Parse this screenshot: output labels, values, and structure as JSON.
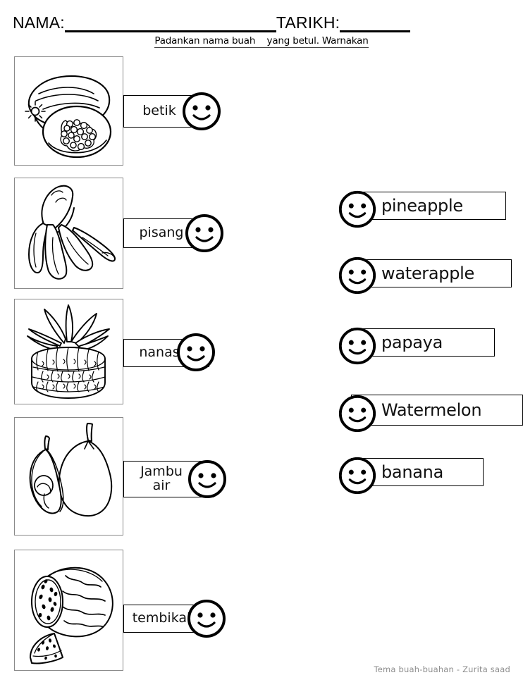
{
  "header": {
    "name_label": "NAMA:",
    "date_label": "TARIKH:"
  },
  "instruction": "Padankan nama buah    yang betul. Warnakan",
  "left_column": [
    {
      "label": "betik",
      "picture": "papaya-drawing"
    },
    {
      "label": "pisang",
      "picture": "banana-drawing"
    },
    {
      "label": "nanas",
      "picture": "pineapple-drawing"
    },
    {
      "label": "Jambu\nair",
      "picture": "waterapple-drawing"
    },
    {
      "label": "tembikai",
      "picture": "watermelon-drawing"
    }
  ],
  "right_column": [
    {
      "label": "pineapple"
    },
    {
      "label": "waterapple"
    },
    {
      "label": "papaya"
    },
    {
      "label": "Watermelon"
    },
    {
      "label": "banana"
    }
  ],
  "footer": "Tema buah-buahan - Zurita saad",
  "colors": {
    "ink": "#000000",
    "picture_border": "#8a8a8a",
    "footer_text": "#8d8d8d",
    "page_background": "#ffffff"
  }
}
